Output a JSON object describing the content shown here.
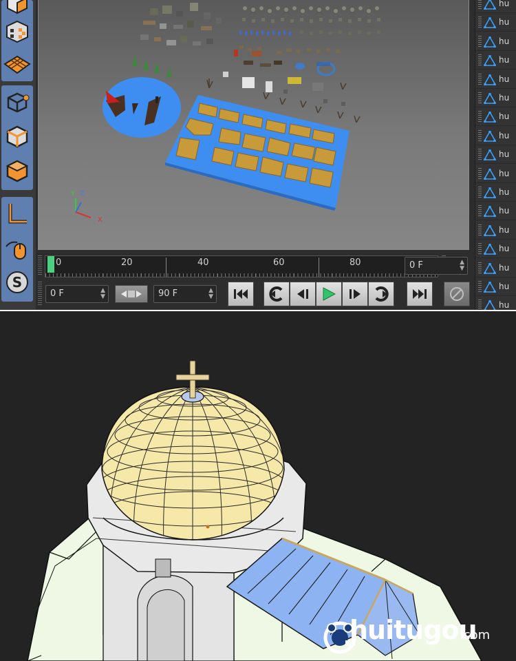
{
  "timeline": {
    "ruler_labels": [
      "0",
      "20",
      "40",
      "60",
      "80"
    ],
    "current_frame": "0 F",
    "start_frame": "0 F",
    "end_frame": "90 F"
  },
  "object_manager": {
    "row_label": "hu",
    "row_count": 17
  },
  "transport": {
    "buttons": [
      "go-to-start",
      "previous-key",
      "previous-frame",
      "play",
      "next-frame",
      "next-key",
      "go-to-end",
      "record"
    ]
  },
  "axis": {
    "x": "X",
    "y": "Y",
    "z": "Z"
  },
  "watermark": {
    "brand": "huitugou",
    "suffix": ".com"
  },
  "colors": {
    "playhead": "#4cd07d",
    "toolbar_active": "#5e7fb0",
    "object_icon": "#3aa0ff"
  }
}
